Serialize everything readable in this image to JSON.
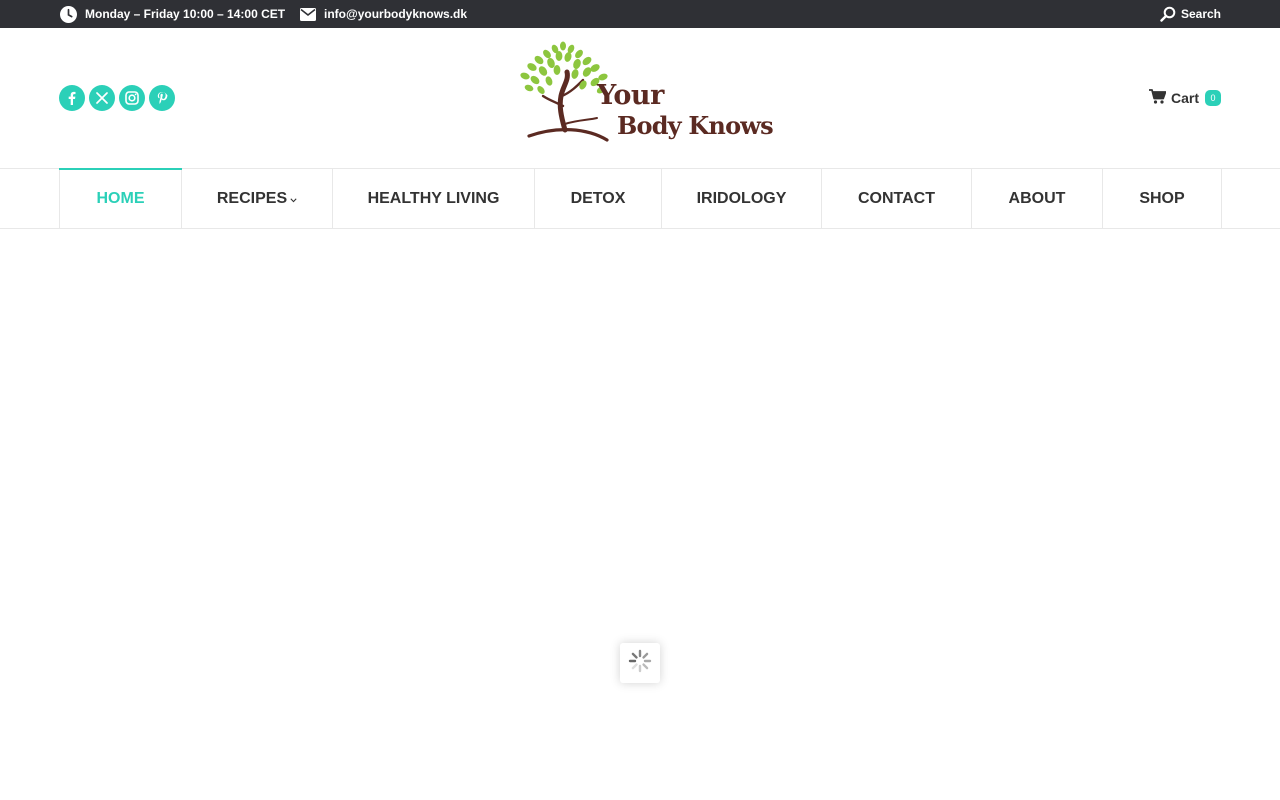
{
  "topbar": {
    "hours_icon": "clock-icon",
    "hours": "Monday – Friday 10:00 – 14:00 CET",
    "email_icon": "envelope-icon",
    "email": "info@yourbodyknows.dk",
    "search_icon": "search-icon",
    "search_label": "Search"
  },
  "header": {
    "socials": [
      {
        "icon": "facebook-icon"
      },
      {
        "icon": "x-twitter-icon"
      },
      {
        "icon": "instagram-icon"
      },
      {
        "icon": "pinterest-icon"
      }
    ],
    "logo": {
      "line1": "Your",
      "line2": "Body Knows"
    },
    "cart": {
      "icon": "cart-icon",
      "label": "Cart",
      "count": "0"
    }
  },
  "nav": {
    "items": [
      {
        "label": "HOME",
        "active": true
      },
      {
        "label": "RECIPES",
        "has_submenu": true
      },
      {
        "label": "HEALTHY LIVING"
      },
      {
        "label": "DETOX"
      },
      {
        "label": "IRIDOLOGY"
      },
      {
        "label": "CONTACT"
      },
      {
        "label": "ABOUT"
      },
      {
        "label": "SHOP"
      }
    ]
  },
  "loader": {
    "icon": "spinner-icon"
  },
  "colors": {
    "accent": "#2bd0b8",
    "topbar_bg": "#2f3035",
    "logo_brown": "#5b2a22",
    "logo_green": "#8dc63f"
  }
}
